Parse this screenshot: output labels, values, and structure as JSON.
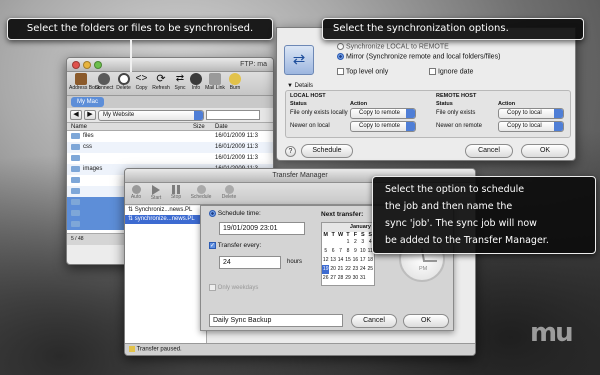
{
  "callouts": {
    "folders": "Select the folders or files to be synchronised.",
    "options": "Select the synchronization options.",
    "schedule_lines": [
      "Select the option to schedule",
      "the job and then name the",
      "sync 'job'. The sync job will now",
      "be added to the Transfer Manager."
    ]
  },
  "ftp_window": {
    "title": "FTP: ma",
    "toolbar": [
      "Address Book",
      "Connect",
      "Delete",
      "Copy",
      "Refresh",
      "Sync",
      "Info",
      "Mail Link",
      "Burn"
    ],
    "local_tab": "My Mac",
    "path_select": "My Website",
    "columns": {
      "name": "Name",
      "size": "Size",
      "date": "Date"
    },
    "rows": [
      {
        "name": "files",
        "date": "16/01/2009 11:3"
      },
      {
        "name": "css",
        "date": "16/01/2009 11:3"
      },
      {
        "name": "",
        "date": "16/01/2009 11:3"
      },
      {
        "name": "images",
        "date": "16/01/2009 11:3"
      },
      {
        "name": "",
        "date": "16/01/2009 11:3"
      },
      {
        "name": "",
        "date": "16/01/2009 11:3"
      },
      {
        "name": "",
        "date": "16/01/2009 11:3"
      },
      {
        "name": "",
        "date": "16/01/2009 11:3"
      },
      {
        "name": "",
        "date": "16/01/2009 11:3"
      }
    ],
    "status": "5 / 48"
  },
  "sync_sheet": {
    "radio_local_remote": "Synchronize LOCAL to REMOTE",
    "radio_mirror": "Mirror (Synchronize remote and local folders/files)",
    "top_level_only": "Top level only",
    "ignore_date": "Ignore date",
    "details_label": "Details",
    "local_host": "LOCAL HOST",
    "remote_host": "REMOTE HOST",
    "status_col": "Status",
    "action_col": "Action",
    "rows": [
      {
        "status": "File only exists locally",
        "action": "Copy to remote"
      },
      {
        "status": "Newer on local",
        "action": "Copy to remote"
      }
    ],
    "remote_rows": [
      {
        "status": "File only exists",
        "action": "Copy to local"
      },
      {
        "status": "Newer on remote",
        "action": "Copy to local"
      }
    ],
    "help": "?",
    "schedule_button": "Schedule",
    "cancel_button": "Cancel",
    "ok_button": "OK"
  },
  "transfer_manager": {
    "title": "Transfer Manager",
    "toolbar": [
      "Auto",
      "Start",
      "Stop",
      "Schedule",
      "Delete"
    ],
    "items": [
      "Synchroniz...news.PL",
      "synchronize...news.PL"
    ],
    "status": "Transfer paused."
  },
  "schedule_sheet": {
    "schedule_time_label": "Schedule time:",
    "schedule_time_value": "19/01/2009 23:01",
    "transfer_every_label": "Transfer every:",
    "transfer_every_value": "24",
    "hours": "hours",
    "next_transfer": "Next transfer:",
    "on_weekdays": "Only weekdays",
    "calendar_month": "January",
    "weekdays": [
      "M",
      "T",
      "W",
      "T",
      "F",
      "S",
      "S"
    ],
    "calendar_rows": [
      [
        "",
        "",
        "",
        "1",
        "2",
        "3",
        "4"
      ],
      [
        "5",
        "6",
        "7",
        "8",
        "9",
        "10",
        "11"
      ],
      [
        "12",
        "13",
        "14",
        "15",
        "16",
        "17",
        "18"
      ],
      [
        "19",
        "20",
        "21",
        "22",
        "23",
        "24",
        "25"
      ],
      [
        "26",
        "27",
        "28",
        "29",
        "30",
        "31",
        ""
      ]
    ],
    "selected_day": "19",
    "clock_label": "PM",
    "job_name": "Daily Sync Backup",
    "cancel_button": "Cancel",
    "ok_button": "OK"
  },
  "logo": "MU",
  "colors": {
    "callout_bg": "#0c0c0c",
    "selection_blue": "#3d6bd1",
    "tab_blue": "#5d8ed8"
  }
}
